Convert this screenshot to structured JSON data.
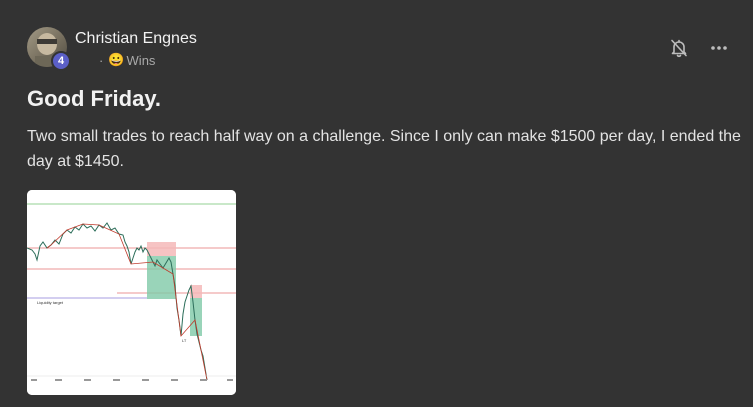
{
  "author": {
    "name": "Christian Engnes",
    "level": "4",
    "avatar_icon": "user-avatar"
  },
  "category": {
    "separator": "·",
    "emoji": "😀",
    "label": "Wins"
  },
  "actions": {
    "bell_icon": "bell-off-icon",
    "more_icon": "ellipsis-icon"
  },
  "post": {
    "title": "Good Friday.",
    "body": "Two small trades to reach half way on a challenge. Since I only can make $1500 per day, I ended the day at $1450."
  },
  "attachment": {
    "type": "chart-screenshot",
    "labels": {
      "liquidity": "Liquidity target",
      "lt": "LT"
    }
  },
  "colors": {
    "background": "#333333",
    "badge": "#5b5fc7"
  }
}
